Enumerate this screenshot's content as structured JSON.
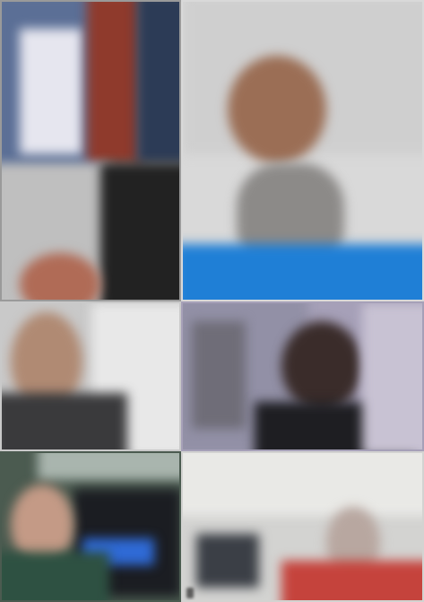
{
  "app": {
    "view": "gallery"
  },
  "participants": [
    {
      "tile": "top-left"
    },
    {
      "tile": "top-right"
    },
    {
      "tile": "middle-left"
    },
    {
      "tile": "middle-right"
    },
    {
      "tile": "bottom-left"
    },
    {
      "tile": "bottom-right"
    }
  ],
  "colors": {
    "background": "#ffffff",
    "blue_shirt": "#1f7fd6",
    "red_shirt": "#c5433c"
  }
}
